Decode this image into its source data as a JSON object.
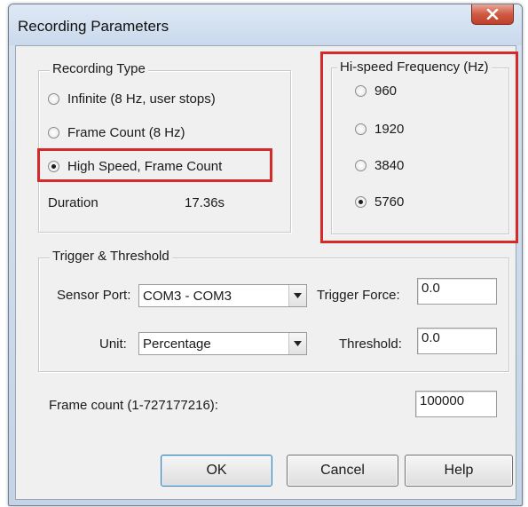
{
  "window": {
    "title": "Recording Parameters"
  },
  "recording_type": {
    "legend": "Recording Type",
    "options": [
      {
        "label": "Infinite (8 Hz, user stops)",
        "selected": false
      },
      {
        "label": "Frame Count (8 Hz)",
        "selected": false
      },
      {
        "label": "High Speed, Frame Count",
        "selected": true
      }
    ],
    "duration_label": "Duration",
    "duration_value": "17.36s"
  },
  "hispeed": {
    "legend": "Hi-speed Frequency (Hz)",
    "options": [
      {
        "label": "960",
        "selected": false
      },
      {
        "label": "1920",
        "selected": false
      },
      {
        "label": "3840",
        "selected": false
      },
      {
        "label": "5760",
        "selected": true
      }
    ]
  },
  "trigger": {
    "legend": "Trigger & Threshold",
    "sensor_port_label": "Sensor Port:",
    "sensor_port_value": "COM3 - COM3",
    "unit_label": "Unit:",
    "unit_value": "Percentage",
    "trigger_force_label": "Trigger Force:",
    "trigger_force_value": "0.0",
    "threshold_label": "Threshold:",
    "threshold_value": "0.0"
  },
  "frame_count": {
    "label": "Frame count (1-727177216):",
    "value": "100000"
  },
  "buttons": {
    "ok": "OK",
    "cancel": "Cancel",
    "help": "Help"
  },
  "highlight_color": "#d42a2a",
  "icons": {
    "close": "close-icon",
    "dropdown": "chevron-down-icon"
  }
}
